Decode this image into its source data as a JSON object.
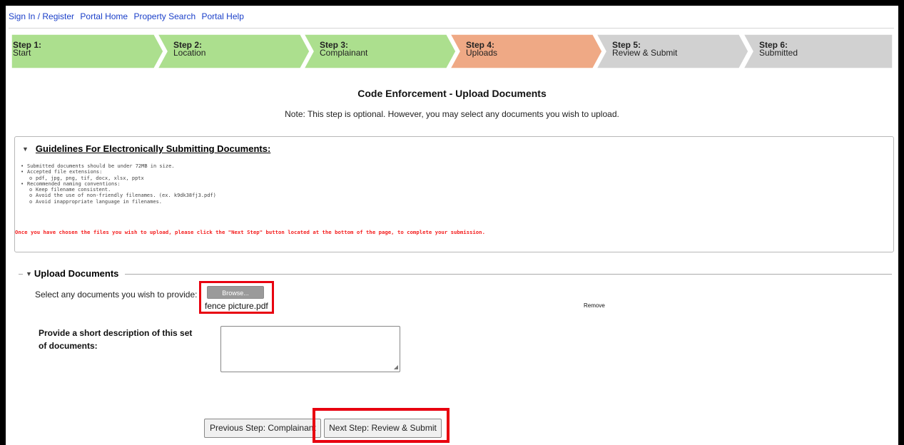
{
  "top_nav": {
    "sign_in": "Sign In / Register",
    "portal_home": "Portal Home",
    "property_search": "Property Search",
    "portal_help": "Portal Help"
  },
  "steps": [
    {
      "num": "Step 1:",
      "name": "Start",
      "state": "complete"
    },
    {
      "num": "Step 2:",
      "name": "Location",
      "state": "complete"
    },
    {
      "num": "Step 3:",
      "name": "Complainant",
      "state": "complete"
    },
    {
      "num": "Step 4:",
      "name": "Uploads",
      "state": "current"
    },
    {
      "num": "Step 5:",
      "name": "Review & Submit",
      "state": "pending"
    },
    {
      "num": "Step 6:",
      "name": "Submitted",
      "state": "pending"
    }
  ],
  "colors": {
    "complete": "#acdf8e",
    "current": "#efa985",
    "pending": "#d1d1d1",
    "highlight": "#e8000f",
    "link": "#1a3fc9"
  },
  "page_title": "Code Enforcement - Upload Documents",
  "note": "Note: This step is optional. However, you may select any documents you wish to upload.",
  "guidelines": {
    "title": "Guidelines For Electronically Submitting Documents:",
    "size_rule": "Submitted documents should be under 72MB in size.",
    "ext_heading": "Accepted file extensions:",
    "extensions": "pdf, jpg, png, tif, docx, xlsx, pptx",
    "naming_heading": "Recommended naming conventions:",
    "naming": [
      "Keep filename consistent.",
      "Avoid the use of non-friendly filenames. (ex. k9dk38fj3.pdf)",
      "Avoid inappropriate language in filenames."
    ],
    "warning": "Once you have chosen the files you wish to upload, please click the \"Next Step\" button located at the bottom of the page, to complete your submission."
  },
  "upload": {
    "legend": "Upload Documents",
    "select_label": "Select any documents you wish to provide:",
    "browse_label": "Browse...",
    "file_name": "fence picture.pdf",
    "remove_label": "Remove",
    "description_label": "Provide a short description of this set of documents:",
    "description_value": ""
  },
  "buttons": {
    "previous": "Previous Step: Complainant",
    "next": "Next Step: Review & Submit"
  }
}
